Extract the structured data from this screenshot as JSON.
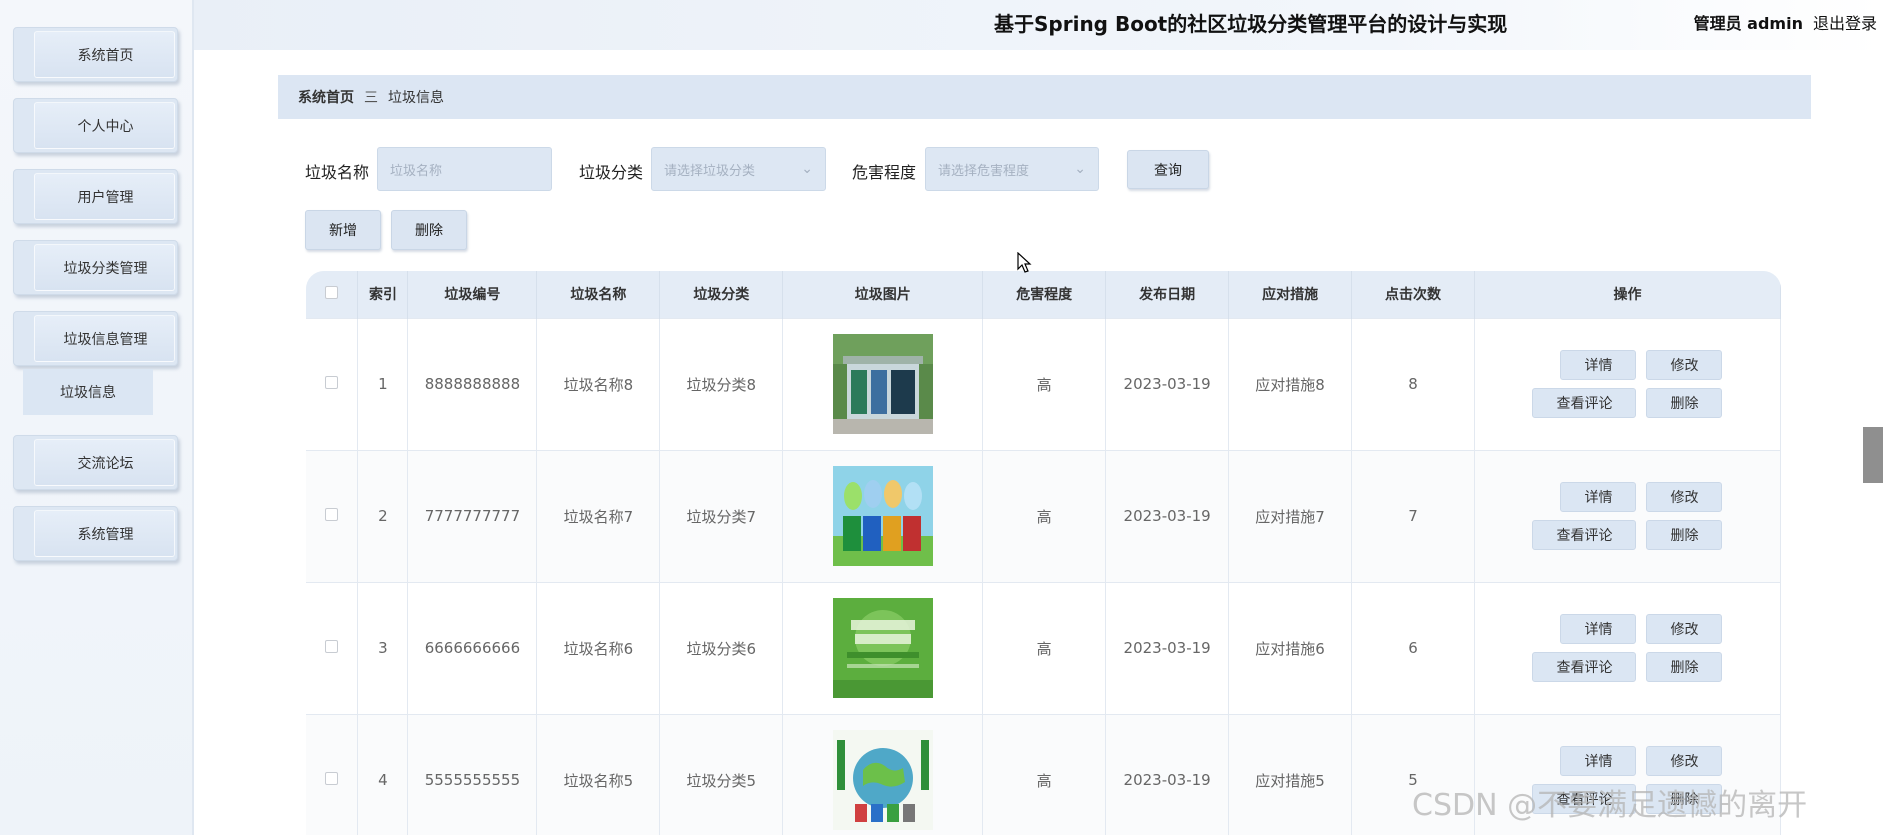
{
  "header": {
    "title": "基于Spring Boot的社区垃圾分类管理平台的设计与实现",
    "role": "管理员 admin",
    "logout": "退出登录"
  },
  "sidebar": {
    "items": [
      {
        "label": "系统首页"
      },
      {
        "label": "个人中心"
      },
      {
        "label": "用户管理"
      },
      {
        "label": "垃圾分类管理"
      },
      {
        "label": "垃圾信息管理"
      },
      {
        "label": "交流论坛"
      },
      {
        "label": "系统管理"
      }
    ],
    "subitem": "垃圾信息"
  },
  "breadcrumb": {
    "home": "系统首页",
    "separator": "三",
    "current": "垃圾信息"
  },
  "search": {
    "name_label": "垃圾名称",
    "name_placeholder": "垃圾名称",
    "category_label": "垃圾分类",
    "category_placeholder": "请选择垃圾分类",
    "hazard_label": "危害程度",
    "hazard_placeholder": "请选择危害程度",
    "query_button": "查询"
  },
  "actions": {
    "add": "新增",
    "delete": "删除"
  },
  "table": {
    "columns": [
      "索引",
      "垃圾编号",
      "垃圾名称",
      "垃圾分类",
      "垃圾图片",
      "危害程度",
      "发布日期",
      "应对措施",
      "点击次数",
      "操作"
    ],
    "rows": [
      {
        "index": "1",
        "code": "8888888888",
        "name": "垃圾名称8",
        "category": "垃圾分类8",
        "hazard": "高",
        "date": "2023-03-19",
        "measure": "应对措施8",
        "clicks": "8",
        "image": "recycling-kiosk"
      },
      {
        "index": "2",
        "code": "7777777777",
        "name": "垃圾名称7",
        "category": "垃圾分类7",
        "hazard": "高",
        "date": "2023-03-19",
        "measure": "应对措施7",
        "clicks": "7",
        "image": "colored-bins"
      },
      {
        "index": "3",
        "code": "6666666666",
        "name": "垃圾名称6",
        "category": "垃圾分类6",
        "hazard": "高",
        "date": "2023-03-19",
        "measure": "应对措施6",
        "clicks": "6",
        "image": "green-poster"
      },
      {
        "index": "4",
        "code": "5555555555",
        "name": "垃圾名称5",
        "category": "垃圾分类5",
        "hazard": "高",
        "date": "2023-03-19",
        "measure": "应对措施5",
        "clicks": "5",
        "image": "earth-cartoon"
      }
    ],
    "row_actions": {
      "detail": "详情",
      "edit": "修改",
      "comments": "查看评论",
      "delete": "删除"
    }
  },
  "watermark": "CSDN @不要满足遗憾的离开",
  "colors": {
    "accent": "#dbe6f3",
    "sidebar_bg": "#eef3f9"
  }
}
